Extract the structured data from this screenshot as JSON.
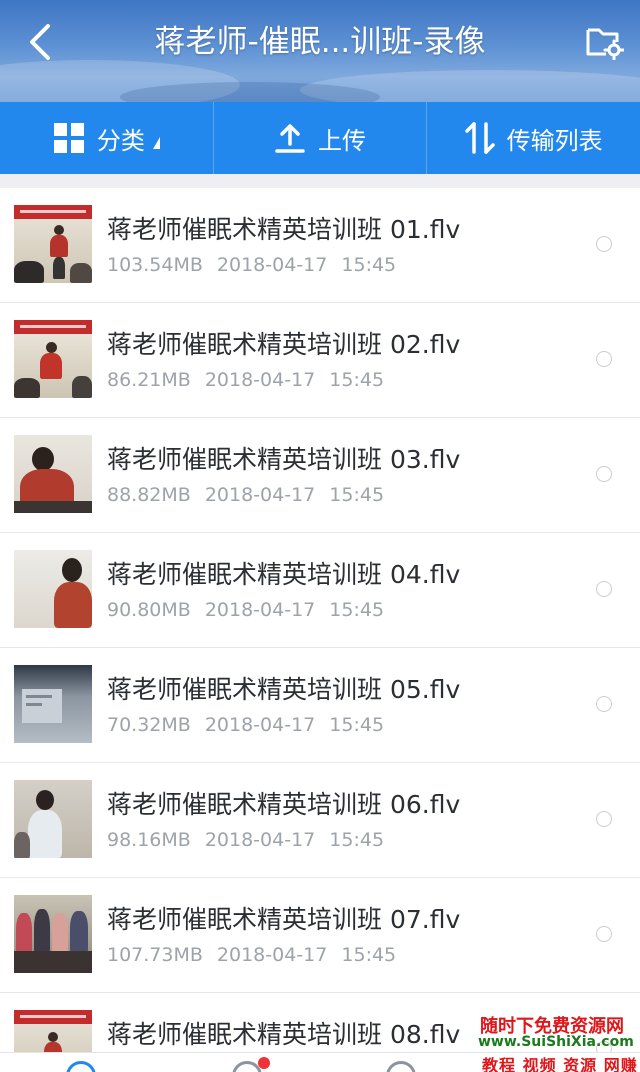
{
  "header": {
    "title": "蒋老师-催眠...训班-录像",
    "back_icon": "chevron-left-icon",
    "folder_settings_icon": "folder-gear-icon"
  },
  "toolbar": {
    "items": [
      {
        "label": "分类",
        "icon": "grid-icon"
      },
      {
        "label": "上传",
        "icon": "upload-icon"
      },
      {
        "label": "传输列表",
        "icon": "transfer-arrows-icon"
      }
    ]
  },
  "files": [
    {
      "name": "蒋老师催眠术精英培训班 01.flv",
      "size": "103.54MB",
      "date": "2018-04-17",
      "time": "15:45"
    },
    {
      "name": "蒋老师催眠术精英培训班 02.flv",
      "size": "86.21MB",
      "date": "2018-04-17",
      "time": "15:45"
    },
    {
      "name": "蒋老师催眠术精英培训班 03.flv",
      "size": "88.82MB",
      "date": "2018-04-17",
      "time": "15:45"
    },
    {
      "name": "蒋老师催眠术精英培训班 04.flv",
      "size": "90.80MB",
      "date": "2018-04-17",
      "time": "15:45"
    },
    {
      "name": "蒋老师催眠术精英培训班 05.flv",
      "size": "70.32MB",
      "date": "2018-04-17",
      "time": "15:45"
    },
    {
      "name": "蒋老师催眠术精英培训班 06.flv",
      "size": "98.16MB",
      "date": "2018-04-17",
      "time": "15:45"
    },
    {
      "name": "蒋老师催眠术精英培训班 07.flv",
      "size": "107.73MB",
      "date": "2018-04-17",
      "time": "15:45"
    },
    {
      "name": "蒋老师催眠术精英培训班 08.flv",
      "size": "",
      "date": "",
      "time": ""
    }
  ],
  "watermark": {
    "line1": "随时下免费资源网",
    "line2": "www.SuiShiXia.com",
    "line3": "教程 视频 资源 网赚"
  },
  "colors": {
    "accent": "#2388ee",
    "text_primary": "#2b2e33",
    "text_secondary": "#9ea3aa",
    "badge": "#f0303a"
  }
}
